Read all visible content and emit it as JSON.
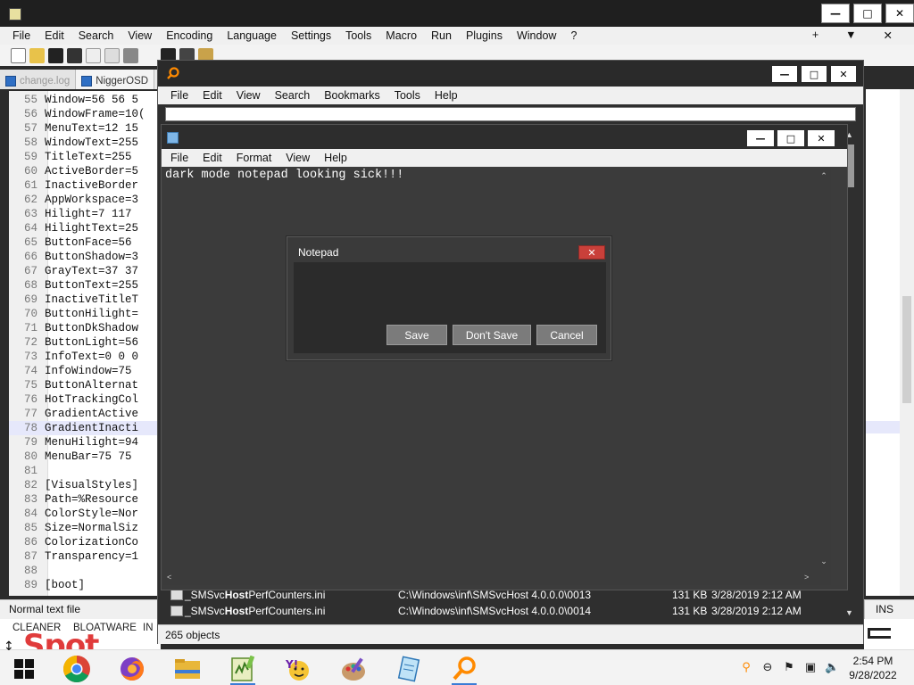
{
  "notepadpp": {
    "menu": [
      "File",
      "Edit",
      "Search",
      "View",
      "Encoding",
      "Language",
      "Settings",
      "Tools",
      "Macro",
      "Run",
      "Plugins",
      "Window",
      "?"
    ],
    "menu_right": [
      "+",
      "▼",
      "✕"
    ],
    "tabs": [
      "change.log",
      "NiggerOSD"
    ],
    "code_lines": [
      {
        "n": "55",
        "t": "Window=56 56 5"
      },
      {
        "n": "56",
        "t": "WindowFrame=10("
      },
      {
        "n": "57",
        "t": "MenuText=12 15"
      },
      {
        "n": "58",
        "t": "WindowText=255"
      },
      {
        "n": "59",
        "t": "TitleText=255"
      },
      {
        "n": "60",
        "t": "ActiveBorder=5"
      },
      {
        "n": "61",
        "t": "InactiveBorder"
      },
      {
        "n": "62",
        "t": "AppWorkspace=3"
      },
      {
        "n": "63",
        "t": "Hilight=7 117"
      },
      {
        "n": "64",
        "t": "HilightText=25"
      },
      {
        "n": "65",
        "t": "ButtonFace=56"
      },
      {
        "n": "66",
        "t": "ButtonShadow=3"
      },
      {
        "n": "67",
        "t": "GrayText=37 37"
      },
      {
        "n": "68",
        "t": "ButtonText=255"
      },
      {
        "n": "69",
        "t": "InactiveTitleT"
      },
      {
        "n": "70",
        "t": "ButtonHilight="
      },
      {
        "n": "71",
        "t": "ButtonDkShadow"
      },
      {
        "n": "72",
        "t": "ButtonLight=56"
      },
      {
        "n": "73",
        "t": "InfoText=0 0 0"
      },
      {
        "n": "74",
        "t": "InfoWindow=75"
      },
      {
        "n": "75",
        "t": "ButtonAlternat"
      },
      {
        "n": "76",
        "t": "HotTrackingCol"
      },
      {
        "n": "77",
        "t": "GradientActive"
      },
      {
        "n": "78",
        "t": "GradientInacti"
      },
      {
        "n": "79",
        "t": "MenuHilight=94"
      },
      {
        "n": "80",
        "t": "MenuBar=75 75"
      },
      {
        "n": "81",
        "t": ""
      },
      {
        "n": "82",
        "t": "[VisualStyles]"
      },
      {
        "n": "83",
        "t": "Path=%Resource"
      },
      {
        "n": "84",
        "t": "ColorStyle=Nor"
      },
      {
        "n": "85",
        "t": "Size=NormalSiz"
      },
      {
        "n": "86",
        "t": "ColorizationCo"
      },
      {
        "n": "87",
        "t": "Transparency=1"
      },
      {
        "n": "88",
        "t": ""
      },
      {
        "n": "89",
        "t": "[boot]"
      }
    ],
    "highlight_line": "78",
    "status_text": "Normal text file",
    "status_mode": "INS"
  },
  "desktop": {
    "labels": [
      "CLEANER",
      "BLOATWARE",
      "IN"
    ],
    "banner_text": "Spot"
  },
  "everything": {
    "menu": [
      "File",
      "Edit",
      "View",
      "Search",
      "Bookmarks",
      "Tools",
      "Help"
    ],
    "rows": [
      {
        "pre": "_SMSvc",
        "bold": "Host",
        "post": "PerfCounters.ini",
        "path": "C:\\Windows\\inf\\SMSvcHost 4.0.0.0\\0013",
        "size": "131 KB",
        "date": "3/28/2019 2:12 AM"
      },
      {
        "pre": "_SMSvc",
        "bold": "Host",
        "post": "PerfCounters.ini",
        "path": "C:\\Windows\\inf\\SMSvcHost 4.0.0.0\\0014",
        "size": "131 KB",
        "date": "3/28/2019 2:12 AM"
      }
    ],
    "status": "265 objects"
  },
  "notepad": {
    "menu": [
      "File",
      "Edit",
      "Format",
      "View",
      "Help"
    ],
    "content": "dark mode notepad looking sick!!!"
  },
  "dialog": {
    "title": "Notepad",
    "close": "✕",
    "save": "Save",
    "dont_save": "Don't Save",
    "cancel": "Cancel"
  },
  "taskbar": {
    "time": "2:54 PM",
    "date": "9/28/2022",
    "apps": [
      "chrome-icon",
      "firefox-icon",
      "file-explorer-icon",
      "notepadpp-icon",
      "yahoo-messenger-icon",
      "paint-icon",
      "notepad-icon",
      "everything-search-icon"
    ]
  },
  "colors": {
    "dark_bg": "#3b3b3b",
    "dialog_close": "#c9403a",
    "button_gray": "#7b7b7b",
    "accent": "#3b7cd6"
  }
}
